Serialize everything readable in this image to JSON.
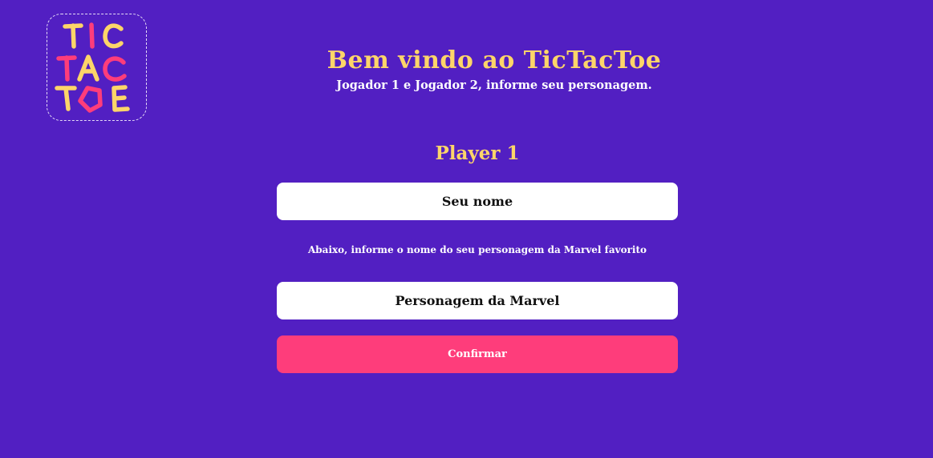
{
  "logo": {
    "lines": [
      "TIC",
      "TAC",
      "TOE"
    ],
    "colors": {
      "yellow": "#fdd569",
      "pink": "#fe3d7b"
    }
  },
  "header": {
    "title": "Bem vindo ao TicTacToe",
    "subtitle": "Jogador 1 e Jogador 2, informe seu personagem."
  },
  "form": {
    "player_heading": "Player 1",
    "name_placeholder": "Seu nome",
    "hint": "Abaixo, informe o nome do seu personagem da Marvel favorito",
    "character_placeholder": "Personagem da Marvel",
    "confirm_label": "Confirmar"
  },
  "theme": {
    "background": "#521fc2",
    "accent_yellow": "#fdd569",
    "button_pink": "#fe3d7b"
  }
}
